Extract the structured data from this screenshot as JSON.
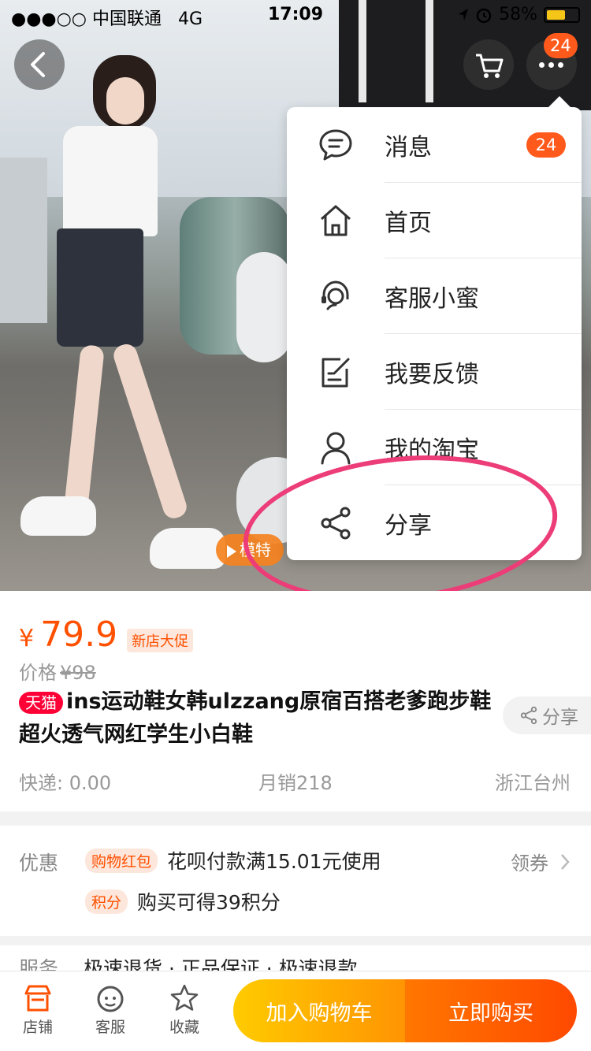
{
  "status_bar": {
    "carrier": "●●●○○ 中国联通",
    "network": "4G",
    "time": "17:09",
    "battery": "58%"
  },
  "header": {
    "message_count": "24",
    "video_badge_label": "模特"
  },
  "menu": {
    "items": [
      {
        "label": "消息",
        "badge": "24"
      },
      {
        "label": "首页"
      },
      {
        "label": "客服小蜜"
      },
      {
        "label": "我要反馈"
      },
      {
        "label": "我的淘宝"
      },
      {
        "label": "分享"
      }
    ]
  },
  "product": {
    "currency": "¥",
    "price": "79.9",
    "promo_tag": "新店大促",
    "original_price_label": "价格",
    "original_price": "¥98",
    "platform_tag": "天猫",
    "title": "ins运动鞋女韩ulzzang原宿百搭老爹跑步鞋超火透气网红学生小白鞋",
    "share_label": "分享",
    "shipping": "快递: 0.00",
    "monthly_sales": "月销218",
    "location": "浙江台州"
  },
  "promotions": {
    "label": "优惠",
    "red_packet_tag": "购物红包",
    "red_packet_text": "花呗付款满15.01元使用",
    "coupon_link": "领券",
    "points_tag": "积分",
    "points_text": "购买可得39积分"
  },
  "services": {
    "label": "服务",
    "items": "极速退货 · 正品保证 · 极速退款"
  },
  "bottom_bar": {
    "store_label": "店铺",
    "service_label": "客服",
    "favorite_label": "收藏",
    "add_to_cart_label": "加入购物车",
    "buy_now_label": "立即购买"
  },
  "colors": {
    "accent": "#ff5000",
    "badge": "#ff5a1c",
    "tmall": "#ff0036",
    "highlight_ring": "#ec3d78"
  }
}
